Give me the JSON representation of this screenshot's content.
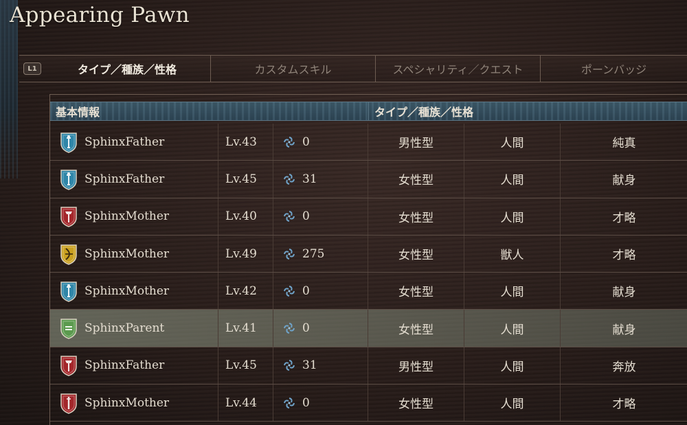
{
  "title": "Appearing Pawn",
  "tab_badge": "L1",
  "tabs": [
    {
      "label": "タイプ／種族／性格",
      "active": true
    },
    {
      "label": "カスタムスキル",
      "active": false
    },
    {
      "label": "スペシャリティ／クエスト",
      "active": false
    },
    {
      "label": "ポーンバッジ",
      "active": false
    }
  ],
  "table": {
    "headers": [
      "基本情報",
      "タイプ／種族／性格"
    ],
    "rows": [
      {
        "name": "SphinxFather",
        "level": "Lv.43",
        "rank": "0",
        "type": "男性型",
        "race": "人間",
        "personality": "純真",
        "vocation_icon": "fighter-shield-icon",
        "vocation_color": "#2f86a8"
      },
      {
        "name": "SphinxFather",
        "level": "Lv.45",
        "rank": "31",
        "type": "女性型",
        "race": "人間",
        "personality": "献身",
        "vocation_icon": "fighter-shield-icon",
        "vocation_color": "#2f86a8"
      },
      {
        "name": "SphinxMother",
        "level": "Lv.40",
        "rank": "0",
        "type": "女性型",
        "race": "人間",
        "personality": "才略",
        "vocation_icon": "warrior-shield-icon",
        "vocation_color": "#a3262a"
      },
      {
        "name": "SphinxMother",
        "level": "Lv.49",
        "rank": "275",
        "type": "女性型",
        "race": "獣人",
        "personality": "才略",
        "vocation_icon": "archer-shield-icon",
        "vocation_color": "#c9a020"
      },
      {
        "name": "SphinxMother",
        "level": "Lv.42",
        "rank": "0",
        "type": "女性型",
        "race": "人間",
        "personality": "献身",
        "vocation_icon": "fighter-shield-icon",
        "vocation_color": "#2f86a8"
      },
      {
        "name": "SphinxParent",
        "level": "Lv.41",
        "rank": "0",
        "type": "女性型",
        "race": "人間",
        "personality": "献身",
        "vocation_icon": "mage-shield-icon",
        "vocation_color": "#5b9a4e",
        "selected": true
      },
      {
        "name": "SphinxFather",
        "level": "Lv.45",
        "rank": "31",
        "type": "男性型",
        "race": "人間",
        "personality": "奔放",
        "vocation_icon": "warrior-shield-icon",
        "vocation_color": "#a3262a"
      },
      {
        "name": "SphinxMother",
        "level": "Lv.44",
        "rank": "0",
        "type": "女性型",
        "race": "人間",
        "personality": "才略",
        "vocation_icon": "thief-shield-icon",
        "vocation_color": "#a3262a"
      }
    ]
  }
}
